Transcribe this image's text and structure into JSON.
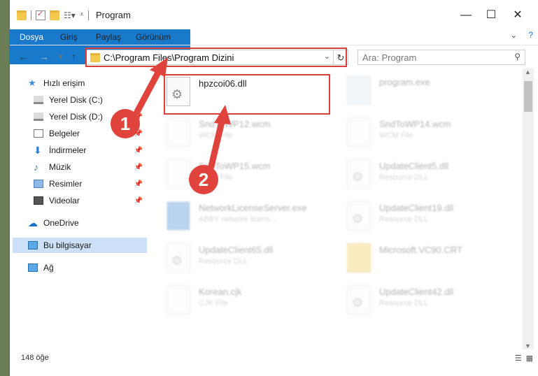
{
  "window": {
    "title": "Program"
  },
  "ribbon": {
    "tabs": [
      "Dosya",
      "Giriş",
      "Paylaş",
      "Görünüm"
    ]
  },
  "address": {
    "path": "C:\\Program Files\\Program Dizini"
  },
  "search": {
    "placeholder": "Ara: Program"
  },
  "sidebar": {
    "items": [
      {
        "label": "Hızlı erişim",
        "icon": "star-icon"
      },
      {
        "label": "Yerel Disk (C:)",
        "icon": "drive-icon",
        "pinned": true
      },
      {
        "label": "Yerel Disk (D:)",
        "icon": "drive-icon",
        "pinned": true
      },
      {
        "label": "Belgeler",
        "icon": "documents-icon",
        "pinned": true
      },
      {
        "label": "İndirmeler",
        "icon": "download-icon",
        "pinned": true
      },
      {
        "label": "Müzik",
        "icon": "music-icon",
        "pinned": true
      },
      {
        "label": "Resimler",
        "icon": "pictures-icon",
        "pinned": true
      },
      {
        "label": "Videolar",
        "icon": "videos-icon",
        "pinned": true
      },
      {
        "label": "OneDrive",
        "icon": "cloud-icon"
      },
      {
        "label": "Bu bilgisayar",
        "icon": "computer-icon",
        "selected": true
      },
      {
        "label": "Ağ",
        "icon": "network-icon"
      }
    ]
  },
  "files": {
    "highlight": {
      "name": "hpzcoi06.dll"
    },
    "items": [
      {
        "name": "program.exe",
        "sub": ""
      },
      {
        "name": "SndToWP12.wcm",
        "sub": "WCM File"
      },
      {
        "name": "SndToWP14.wcm",
        "sub": "WCM File"
      },
      {
        "name": "SndToWP15.wcm",
        "sub": "WCM File"
      },
      {
        "name": "UpdateClient5.dll",
        "sub": "Resource DLL"
      },
      {
        "name": "NetworkLicenseServer.exe",
        "sub": "ABBY network licens..."
      },
      {
        "name": "UpdateClient19.dll",
        "sub": "Resource DLL"
      },
      {
        "name": "UpdateClient65.dll",
        "sub": "Resource DLL"
      },
      {
        "name": "Microsoft.VC90.CRT",
        "sub": ""
      },
      {
        "name": "Korean.cjk",
        "sub": "CJK File"
      },
      {
        "name": "UpdateClient42.dll",
        "sub": "Resource DLL"
      }
    ]
  },
  "annotations": {
    "step1": "1",
    "step2": "2"
  },
  "status": {
    "count": "148 öğe"
  },
  "colors": {
    "accent": "#1979ca",
    "highlight_box": "#d9403a",
    "selected": "#cce1f7"
  }
}
